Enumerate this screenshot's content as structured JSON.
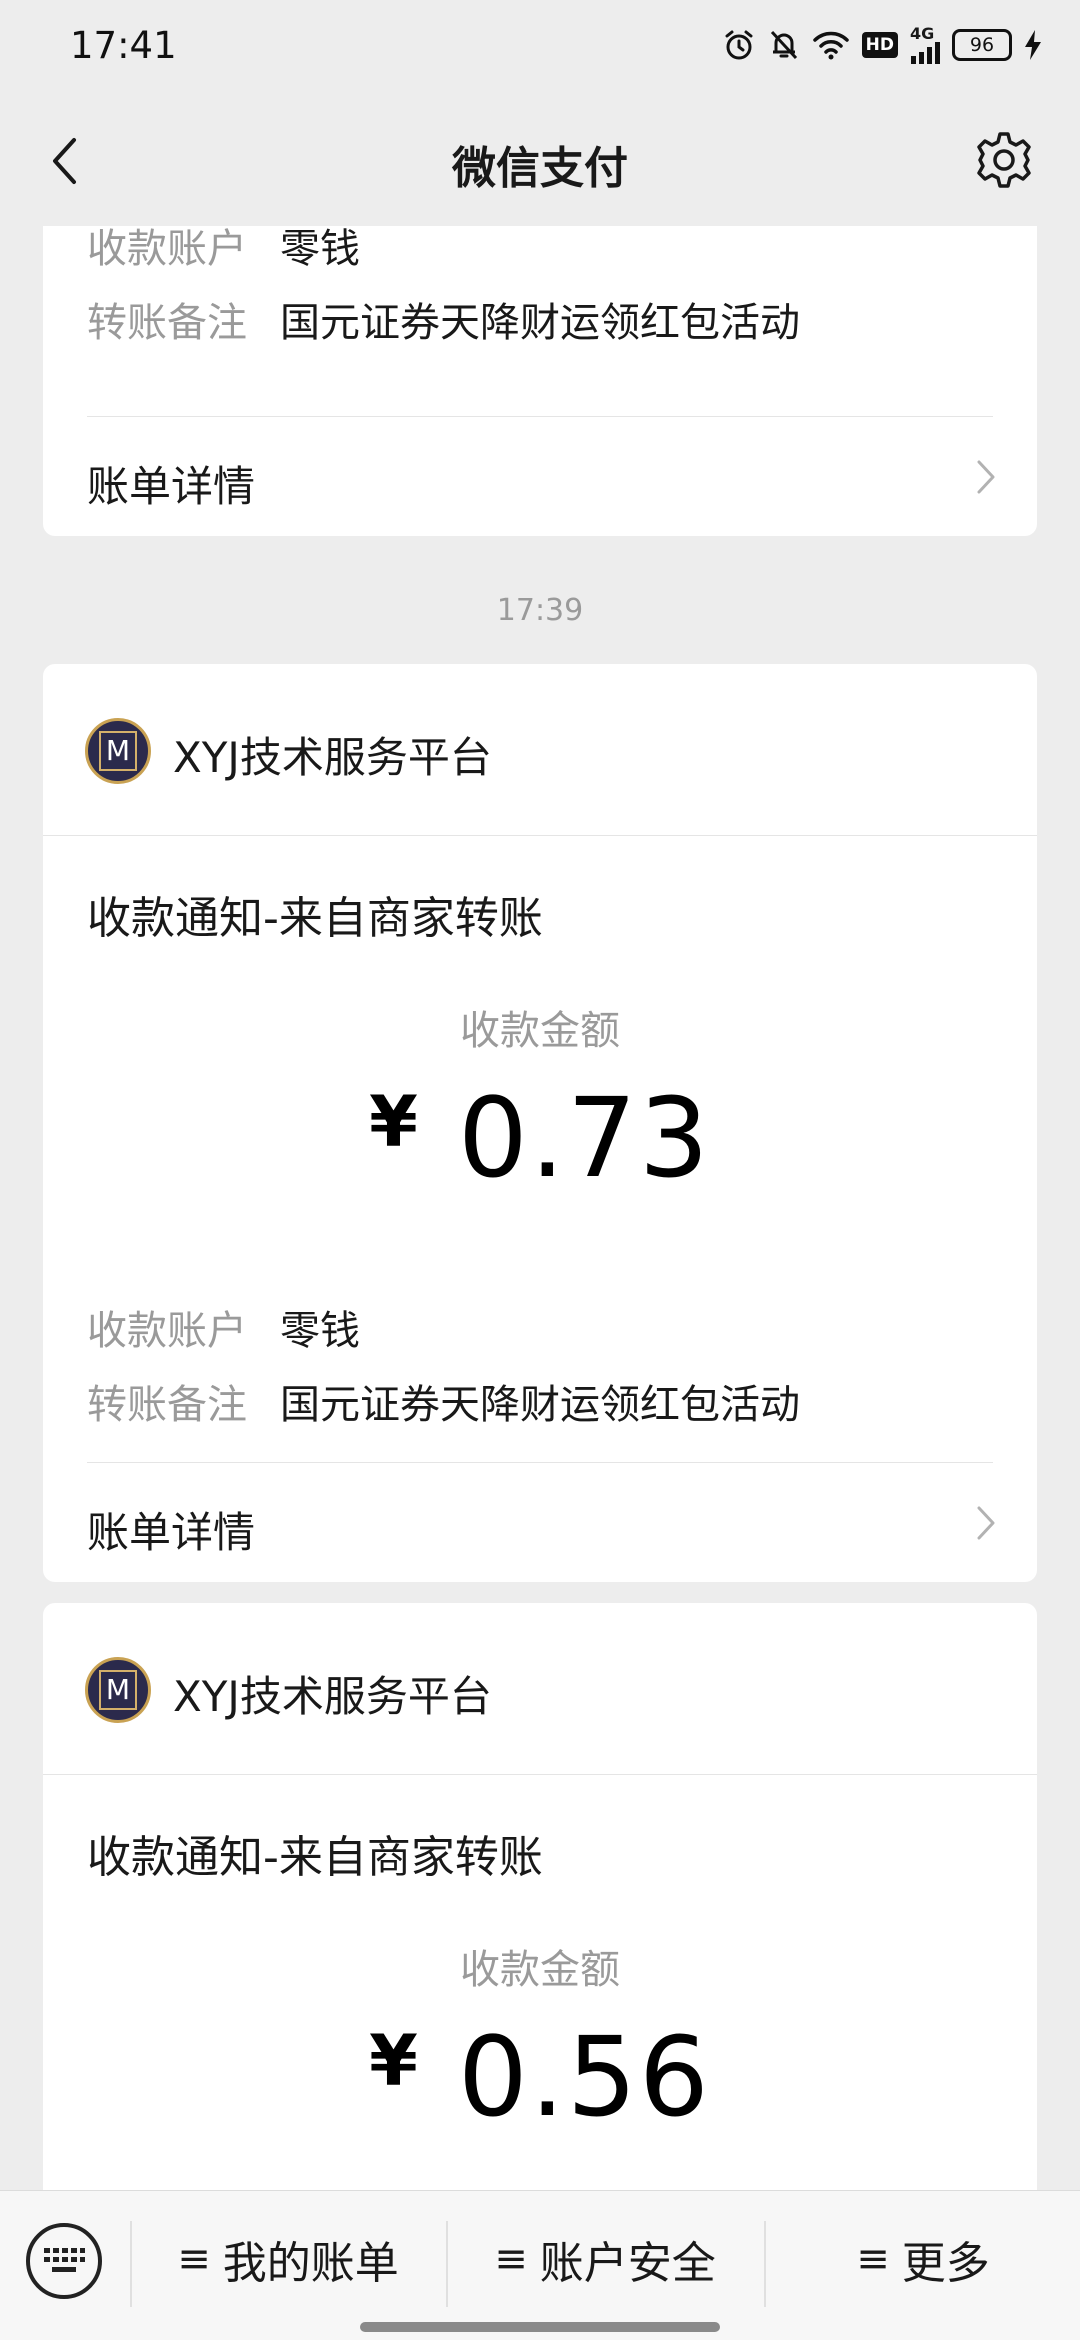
{
  "status_bar": {
    "time": "17:41",
    "network": "4G",
    "hd": "HD",
    "battery": "96",
    "icons": [
      "alarm-icon",
      "mute-icon",
      "wifi-icon",
      "hd-icon",
      "signal-icon",
      "battery-icon",
      "charging-icon"
    ]
  },
  "nav": {
    "title": "微信支付",
    "back_icon": "back-icon",
    "settings_icon": "settings-icon"
  },
  "messages": {
    "partial": {
      "account_label": "收款账户",
      "account_value": "零钱",
      "note_label": "转账备注",
      "note_value": "国元证券天降财运领红包活动",
      "detail_label": "账单详情"
    },
    "timestamp": "17:39",
    "card1": {
      "merchant": "XYJ技术服务平台",
      "logo_letter": "M",
      "title": "收款通知-来自商家转账",
      "amount_label": "收款金额",
      "currency": "¥",
      "amount": "0.73",
      "account_label": "收款账户",
      "account_value": "零钱",
      "note_label": "转账备注",
      "note_value": "国元证券天降财运领红包活动",
      "detail_label": "账单详情"
    },
    "card2": {
      "merchant": "XYJ技术服务平台",
      "logo_letter": "M",
      "title": "收款通知-来自商家转账",
      "amount_label": "收款金额",
      "currency": "¥",
      "amount": "0.56"
    }
  },
  "bottom_bar": {
    "menu_icon": "≡",
    "items": [
      "我的账单",
      "账户安全",
      "更多"
    ]
  },
  "colors": {
    "background": "#ededed",
    "card": "#ffffff",
    "text_primary": "#191919",
    "text_secondary": "#9a9a9a"
  }
}
